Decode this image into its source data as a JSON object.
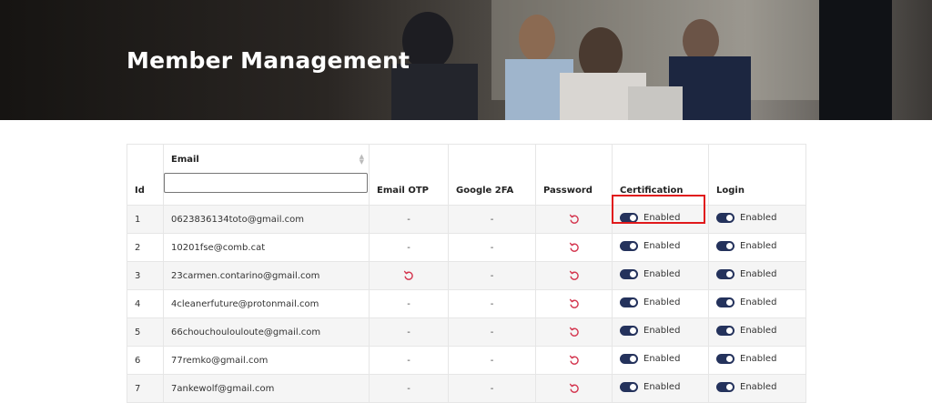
{
  "header": {
    "title": "Member Management"
  },
  "table": {
    "columns": {
      "id": "Id",
      "email": "Email",
      "email_otp": "Email OTP",
      "google_2fa": "Google 2FA",
      "password": "Password",
      "certification": "Certification",
      "login": "Login"
    },
    "email_filter": {
      "value": "",
      "placeholder": ""
    },
    "rows": [
      {
        "id": "1",
        "email": "0623836134toto@gmail.com",
        "email_otp": "-",
        "google_2fa": "-",
        "certification": "Enabled",
        "login": "Enabled"
      },
      {
        "id": "2",
        "email": "10201fse@comb.cat",
        "email_otp": "-",
        "google_2fa": "-",
        "certification": "Enabled",
        "login": "Enabled"
      },
      {
        "id": "3",
        "email": "23carmen.contarino@gmail.com",
        "email_otp": "reset",
        "google_2fa": "-",
        "certification": "Enabled",
        "login": "Enabled"
      },
      {
        "id": "4",
        "email": "4cleanerfuture@protonmail.com",
        "email_otp": "-",
        "google_2fa": "-",
        "certification": "Enabled",
        "login": "Enabled"
      },
      {
        "id": "5",
        "email": "66chouchoulouloute@gmail.com",
        "email_otp": "-",
        "google_2fa": "-",
        "certification": "Enabled",
        "login": "Enabled"
      },
      {
        "id": "6",
        "email": "77remko@gmail.com",
        "email_otp": "-",
        "google_2fa": "-",
        "certification": "Enabled",
        "login": "Enabled"
      },
      {
        "id": "7",
        "email": "7ankewolf@gmail.com",
        "email_otp": "-",
        "google_2fa": "-",
        "certification": "Enabled",
        "login": "Enabled"
      }
    ]
  },
  "icons": {
    "reset": "reset-icon",
    "toggle": "toggle-switch-icon",
    "sort": "sort-icon"
  },
  "colors": {
    "reset_icon": "#d4364f",
    "toggle_on": "#24325c",
    "highlight_border": "#e0191b"
  }
}
